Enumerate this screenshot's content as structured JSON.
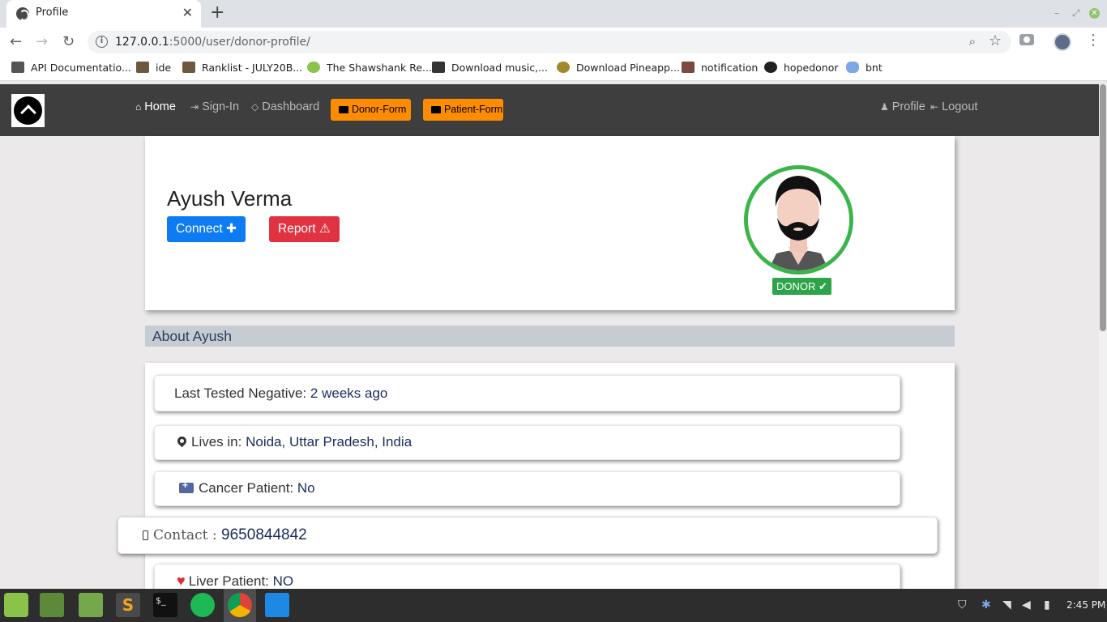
{
  "browser": {
    "tab_title": "Profile",
    "url_host": "127.0.0.1",
    "url_rest": ":5000/user/donor-profile/",
    "bookmarks": [
      "API Documentatio...",
      "ide",
      "Ranklist - JULY20B...",
      "The Shawshank Re...",
      "Download music,...",
      "Download Pineapp...",
      "notification",
      "hopedonor",
      "bnt"
    ]
  },
  "nav": {
    "home": "Home",
    "signin": "Sign-In",
    "dashboard": "Dashboard",
    "donor_form": "Donor-Form",
    "patient_form": "Patient-Form",
    "profile": "Profile",
    "logout": "Logout"
  },
  "profile": {
    "name": "Ayush Verma",
    "connect_label": "Connect",
    "report_label": "Report",
    "badge": "DONOR"
  },
  "about": {
    "title": "About Ayush",
    "tested_label": "Last Tested Negative: ",
    "tested_value": "2 weeks ago",
    "lives_label": "Lives in: ",
    "lives_value": "Noida, Uttar Pradesh, India",
    "cancer_label": "Cancer Patient: ",
    "cancer_value": "No",
    "contact_label": "Contact : ",
    "contact_value": "9650844842",
    "liver_label": "Liver Patient: ",
    "liver_value": "NO"
  },
  "taskbar": {
    "clock": "2:45 PM"
  },
  "colors": {
    "navbar": "#3e3e3e",
    "accent_orange": "#ff8c00",
    "connect_blue": "#0d7cf2",
    "report_red": "#e03341",
    "donor_green": "#2ea44a"
  }
}
